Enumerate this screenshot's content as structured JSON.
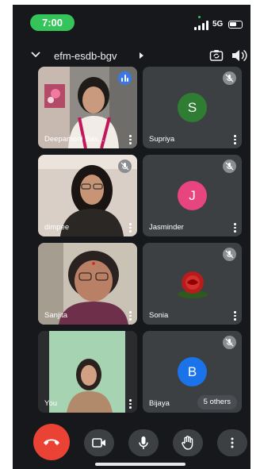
{
  "status_bar": {
    "time": "7:00",
    "network": "5G",
    "icons": [
      "signal-icon",
      "battery-icon"
    ],
    "time_pill_color": "#35c45a"
  },
  "header": {
    "meeting_code": "efm-esdb-bgv",
    "icons": [
      "chevron-down-icon",
      "caret-right-icon",
      "switch-camera-icon",
      "speaker-icon"
    ]
  },
  "participants": [
    {
      "name": "Deepamoni Bas...",
      "type": "video",
      "status": "speaking"
    },
    {
      "name": "Supriya",
      "type": "avatar",
      "initial": "S",
      "avatar_color": "#2e7d32",
      "status": "muted"
    },
    {
      "name": "dimpee",
      "type": "video",
      "status": "muted"
    },
    {
      "name": "Jasminder",
      "type": "avatar",
      "initial": "J",
      "avatar_color": "#e8457f",
      "status": "muted"
    },
    {
      "name": "Sanjita",
      "type": "video",
      "status": "none"
    },
    {
      "name": "Sonia",
      "type": "image",
      "status": "muted"
    },
    {
      "name": "You",
      "type": "video",
      "status": "none"
    },
    {
      "name": "Bijaya",
      "type": "avatar",
      "initial": "B",
      "avatar_color": "#1a73e8",
      "status": "muted",
      "others_label": "5 others"
    }
  ],
  "controls": {
    "items": [
      "end-call-icon",
      "camera-icon",
      "microphone-icon",
      "raise-hand-icon",
      "more-options-icon"
    ],
    "end_call_color": "#ea4335"
  }
}
